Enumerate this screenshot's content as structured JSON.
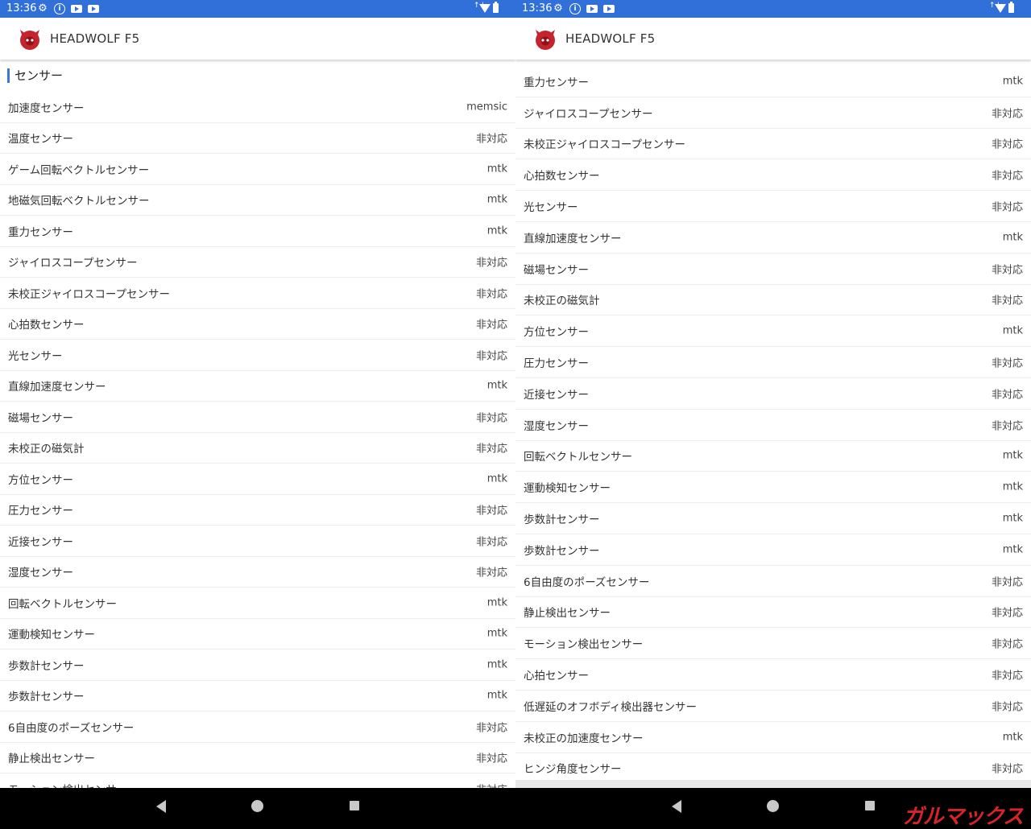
{
  "status": {
    "time": "13:36"
  },
  "app": {
    "title": "HEADWOLF F5"
  },
  "left": {
    "section_title": "センサー",
    "rows": [
      {
        "name": "加速度センサー",
        "value": "memsic"
      },
      {
        "name": "温度センサー",
        "value": "非対応"
      },
      {
        "name": "ゲーム回転ベクトルセンサー",
        "value": "mtk"
      },
      {
        "name": "地磁気回転ベクトルセンサー",
        "value": "mtk"
      },
      {
        "name": "重力センサー",
        "value": "mtk"
      },
      {
        "name": "ジャイロスコープセンサー",
        "value": "非対応"
      },
      {
        "name": "未校正ジャイロスコープセンサー",
        "value": "非対応"
      },
      {
        "name": "心拍数センサー",
        "value": "非対応"
      },
      {
        "name": "光センサー",
        "value": "非対応"
      },
      {
        "name": "直線加速度センサー",
        "value": "mtk"
      },
      {
        "name": "磁場センサー",
        "value": "非対応"
      },
      {
        "name": "未校正の磁気計",
        "value": "非対応"
      },
      {
        "name": "方位センサー",
        "value": "mtk"
      },
      {
        "name": "圧力センサー",
        "value": "非対応"
      },
      {
        "name": "近接センサー",
        "value": "非対応"
      },
      {
        "name": "湿度センサー",
        "value": "非対応"
      },
      {
        "name": "回転ベクトルセンサー",
        "value": "mtk"
      },
      {
        "name": "運動検知センサー",
        "value": "mtk"
      },
      {
        "name": "歩数計センサー",
        "value": "mtk"
      },
      {
        "name": "歩数計センサー",
        "value": "mtk"
      },
      {
        "name": "6自由度のポーズセンサー",
        "value": "非対応"
      },
      {
        "name": "静止検出センサー",
        "value": "非対応"
      },
      {
        "name": "モーション検出センサー",
        "value": "非対応"
      }
    ]
  },
  "right": {
    "rows": [
      {
        "name": "重力センサー",
        "value": "mtk"
      },
      {
        "name": "ジャイロスコープセンサー",
        "value": "非対応"
      },
      {
        "name": "未校正ジャイロスコープセンサー",
        "value": "非対応"
      },
      {
        "name": "心拍数センサー",
        "value": "非対応"
      },
      {
        "name": "光センサー",
        "value": "非対応"
      },
      {
        "name": "直線加速度センサー",
        "value": "mtk"
      },
      {
        "name": "磁場センサー",
        "value": "非対応"
      },
      {
        "name": "未校正の磁気計",
        "value": "非対応"
      },
      {
        "name": "方位センサー",
        "value": "mtk"
      },
      {
        "name": "圧力センサー",
        "value": "非対応"
      },
      {
        "name": "近接センサー",
        "value": "非対応"
      },
      {
        "name": "湿度センサー",
        "value": "非対応"
      },
      {
        "name": "回転ベクトルセンサー",
        "value": "mtk"
      },
      {
        "name": "運動検知センサー",
        "value": "mtk"
      },
      {
        "name": "歩数計センサー",
        "value": "mtk"
      },
      {
        "name": "歩数計センサー",
        "value": "mtk"
      },
      {
        "name": "6自由度のポーズセンサー",
        "value": "非対応"
      },
      {
        "name": "静止検出センサー",
        "value": "非対応"
      },
      {
        "name": "モーション検出センサー",
        "value": "非対応"
      },
      {
        "name": "心拍センサー",
        "value": "非対応"
      },
      {
        "name": "低遅延のオフボディ検出器センサー",
        "value": "非対応"
      },
      {
        "name": "未校正の加速度センサー",
        "value": "mtk"
      },
      {
        "name": "ヒンジ角度センサー",
        "value": "非対応"
      }
    ]
  },
  "watermark": "ガルマックス",
  "icons": {
    "status": [
      "gear-icon",
      "info-icon",
      "youtube-icon",
      "youtube-icon",
      "data-arrows-icon",
      "wifi-icon",
      "battery-icon"
    ],
    "nav": [
      "back-icon",
      "home-icon",
      "recents-icon"
    ],
    "app_logo": "antutu-logo-icon"
  },
  "colors": {
    "status_bar": "#3070d8",
    "section_accent": "#3a78d8",
    "watermark": "#d8232a"
  }
}
